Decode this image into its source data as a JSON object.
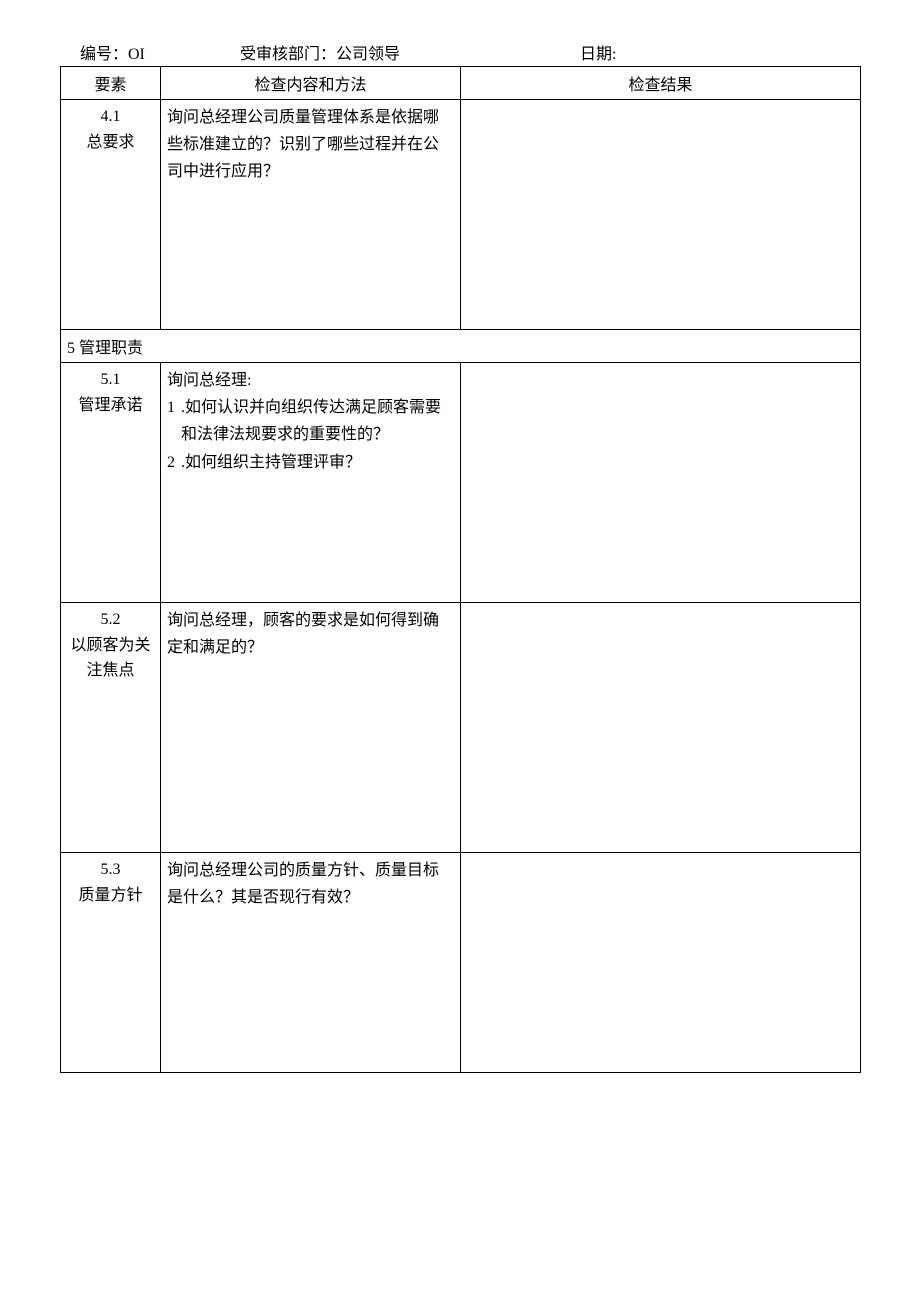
{
  "meta": {
    "id_label": "编号：OI",
    "dept_label": "受审核部门：公司领导",
    "date_label": "日期:"
  },
  "headers": {
    "col1": "要素",
    "col2": "检查内容和方法",
    "col3": "检查结果"
  },
  "rows": {
    "r41_num": "4.1",
    "r41_name": "总要求",
    "r41_content": "询问总经理公司质量管理体系是依据哪些标准建立的？识别了哪些过程并在公司中进行应用？",
    "section5": "5 管理职责",
    "r51_num": "5.1",
    "r51_name": "管理承诺",
    "r51_intro": "询问总经理:",
    "r51_li1_num": "1",
    "r51_li1_text": ".如何认识并向组织传达满足顾客需要和法律法规要求的重要性的？",
    "r51_li2_num": "2",
    "r51_li2_text": ".如何组织主持管理评审？",
    "r52_num": "5.2",
    "r52_name": "以顾客为关注焦点",
    "r52_content": "询问总经理，顾客的要求是如何得到确定和满足的？",
    "r53_num": "5.3",
    "r53_name": "质量方针",
    "r53_content": "询问总经理公司的质量方针、质量目标是什么？其是否现行有效？"
  }
}
